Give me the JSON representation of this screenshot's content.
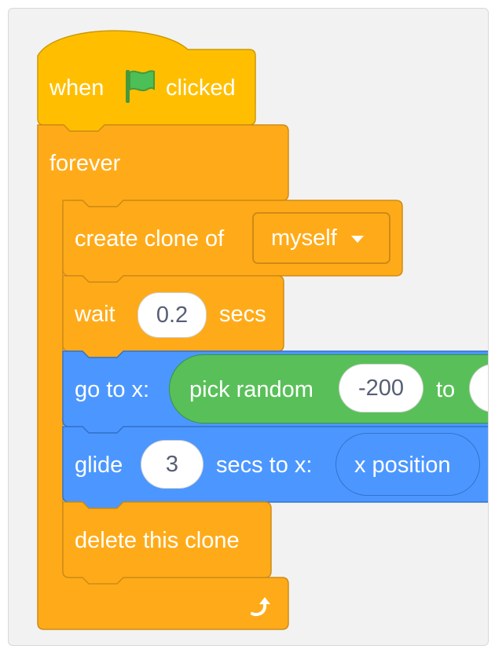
{
  "script": {
    "hat": {
      "when_text": "when",
      "icon": "green-flag-icon",
      "clicked_text": "clicked"
    },
    "forever": {
      "label": "forever",
      "loop_icon": "loop-arrow-icon"
    },
    "create_clone": {
      "label": "create clone of",
      "option": "myself"
    },
    "wait": {
      "label": "wait",
      "value": "0.2",
      "unit": "secs"
    },
    "goto": {
      "label": "go to x:",
      "random_label": "pick random",
      "from": "-200",
      "to_label": "to"
    },
    "glide": {
      "label": "glide",
      "value": "3",
      "mid_label": "secs to x:",
      "reporter": "x position"
    },
    "delete_clone": {
      "label": "delete this clone"
    }
  },
  "colors": {
    "events": "#ffbf00",
    "control": "#ffab19",
    "motion": "#4c97ff",
    "operators": "#59c059",
    "flag": "#4cbf56"
  }
}
